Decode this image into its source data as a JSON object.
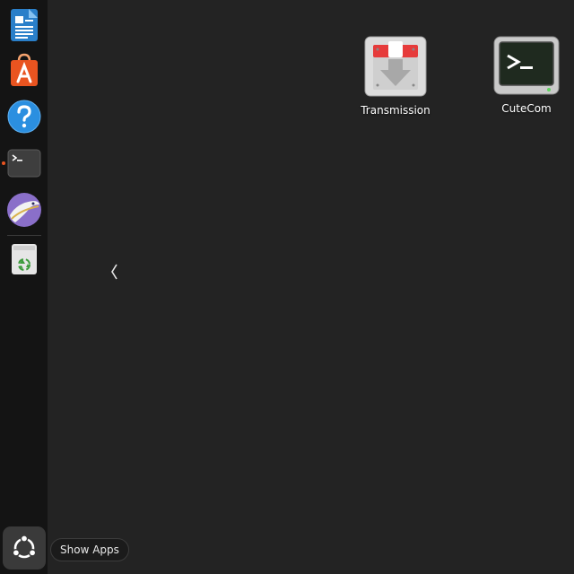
{
  "dock": {
    "items": [
      {
        "name": "LibreOffice Writer",
        "icon": "document-writer-icon"
      },
      {
        "name": "Ubuntu Software",
        "icon": "app-store-bag-icon"
      },
      {
        "name": "Help",
        "icon": "help-question-icon"
      },
      {
        "name": "Terminal",
        "icon": "terminal-icon",
        "running": true
      },
      {
        "name": "Remmina",
        "icon": "remmina-bird-icon"
      },
      {
        "name": "Trash",
        "icon": "trash-recycle-icon"
      }
    ],
    "show_apps_tooltip": "Show Apps"
  },
  "desktop": {
    "icons": [
      {
        "label": "Transmission",
        "icon": "transmission-icon"
      },
      {
        "label": "CuteCom",
        "icon": "cutecom-terminal-icon"
      }
    ]
  },
  "colors": {
    "dock_background": "#141414",
    "desktop_background": "#232323",
    "accent": "#e95420"
  }
}
